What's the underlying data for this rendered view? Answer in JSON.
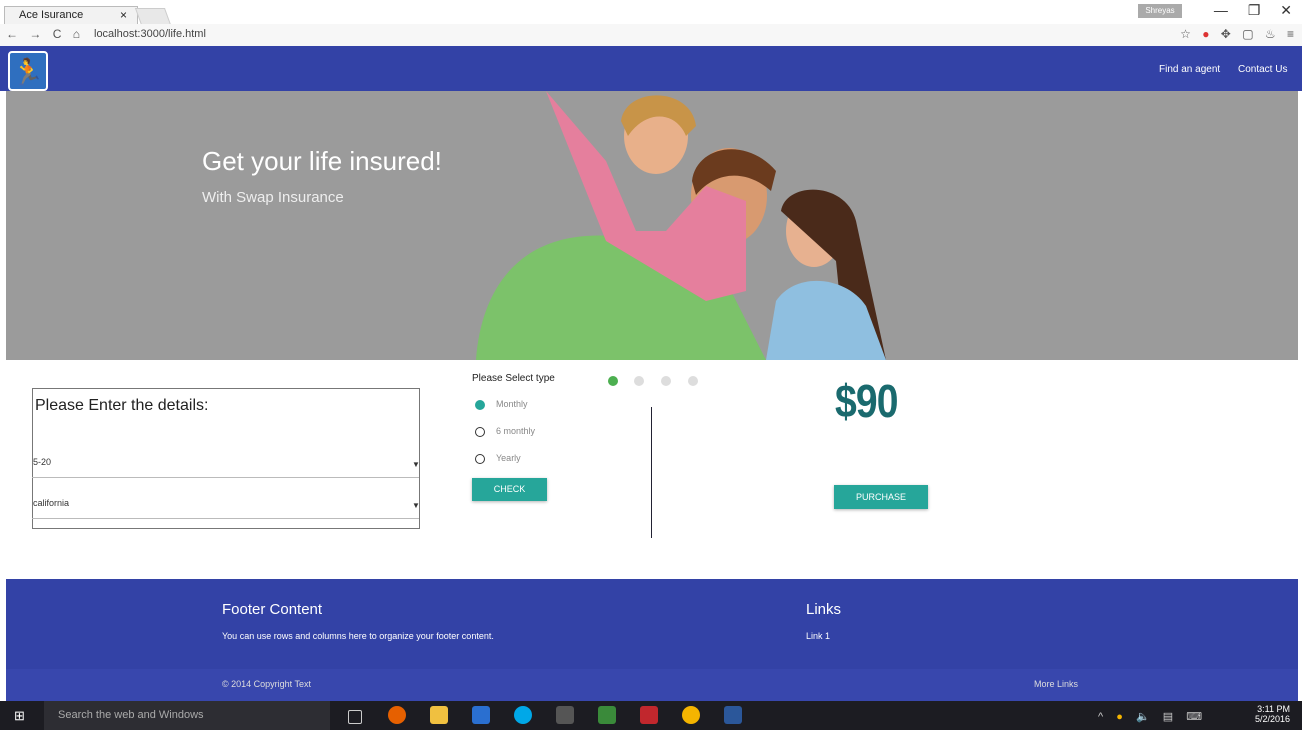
{
  "browser": {
    "tab_title": "Ace Isurance",
    "tab_close": "×",
    "url": "localhost:3000/life.html",
    "user_chip": "Shreyas",
    "win_minimize": "—",
    "win_restore": "❐",
    "win_close": "✕",
    "nav": {
      "back": "←",
      "forward": "→",
      "reload": "C",
      "home": "⌂"
    },
    "ext": {
      "star": "☆",
      "abp": "●",
      "puzzle": "✥",
      "box": "▢",
      "java": "♨",
      "menu": "≡"
    }
  },
  "topnav": {
    "logo_glyph": "🏃",
    "find_agent": "Find an agent",
    "contact_us": "Contact Us"
  },
  "hero": {
    "title": "Get your life insured!",
    "subtitle": "With Swap Insurance"
  },
  "form": {
    "title": "Please Enter the details:",
    "age_value": "5-20",
    "state_value": "california",
    "caret": "▼"
  },
  "plan": {
    "label": "Please Select type",
    "options": [
      "Monthly",
      "6 monthly",
      "Yearly"
    ],
    "selected": "Monthly",
    "check_label": "CHECK",
    "carousel_pages": 4,
    "carousel_active": 1
  },
  "price": {
    "value": "$90",
    "purchase_label": "PURCHASE"
  },
  "footer": {
    "title": "Footer Content",
    "text": "You can use rows and columns here to organize your footer content.",
    "links_title": "Links",
    "link1": "Link 1",
    "copyright": "© 2014 Copyright Text",
    "more_links": "More Links"
  },
  "taskbar": {
    "start": "⊞",
    "search_placeholder": "Search the web and Windows",
    "tray": {
      "chevron": "^",
      "volume": "🔈",
      "notify": "▤",
      "keyboard": "⌨"
    },
    "time": "3:11 PM",
    "date": "5/2/2016"
  },
  "colors": {
    "nav": "#3342a6",
    "accent": "#26a69a",
    "price": "#1a6a6e",
    "hero_bg": "#9b9b9b"
  }
}
